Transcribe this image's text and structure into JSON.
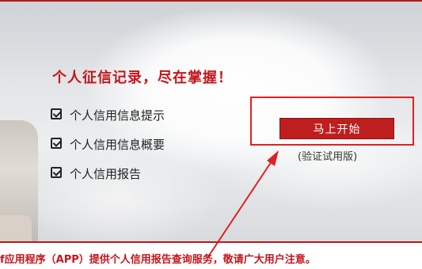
{
  "banner": {
    "headline": "个人征信记录，尽在掌握！",
    "features": [
      {
        "label": "个人信用信息提示",
        "icon": "checkbox-icon"
      },
      {
        "label": "个人信用信息概要",
        "icon": "checkbox-icon"
      },
      {
        "label": "个人信用报告",
        "icon": "checkbox-icon"
      }
    ],
    "start_button_label": "马上开始",
    "trial_note": "(验证试用版)"
  },
  "notice": "f应用程序（APP）提供个人信用报告查询服务，敬请广大用户注意。",
  "colors": {
    "accent_red": "#c4161c",
    "button_red": "#bf1e1e",
    "highlight_red": "#e02020"
  }
}
